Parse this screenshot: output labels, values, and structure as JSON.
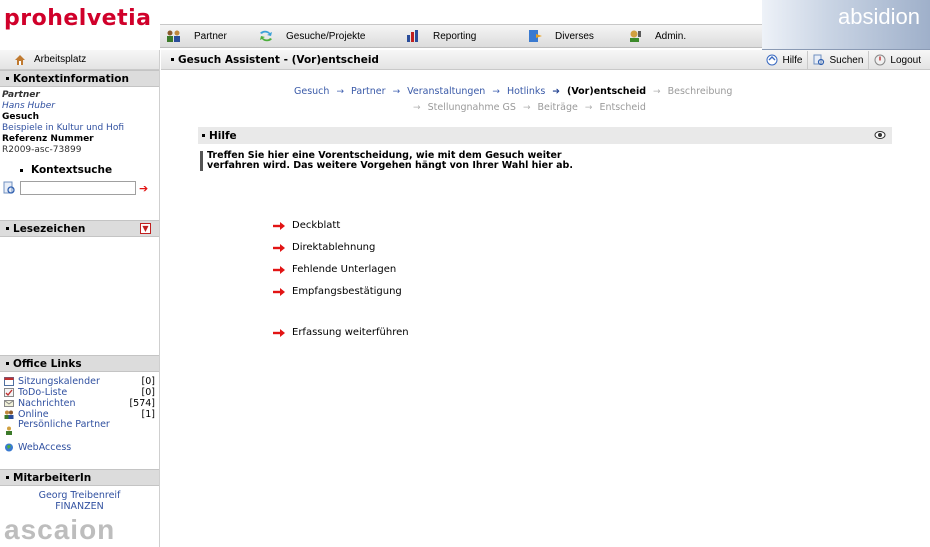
{
  "header": {
    "logo": "prohelvetia",
    "brand": "absidion",
    "nav": [
      {
        "label": "Partner",
        "icon": "partner-icon"
      },
      {
        "label": "Gesuche/Projekte",
        "icon": "projects-icon"
      },
      {
        "label": "Reporting",
        "icon": "reporting-icon"
      },
      {
        "label": "Diverses",
        "icon": "diverses-icon"
      },
      {
        "label": "Admin.",
        "icon": "admin-icon"
      }
    ]
  },
  "sidebar": {
    "home_label": "Arbeitsplatz",
    "kontext": {
      "title": "Kontextinformation",
      "partner_label": "Partner",
      "partner_value": "Hans Huber",
      "gesuch_label": "Gesuch",
      "gesuch_value": "Beispiele in Kultur und Hofi",
      "ref_label": "Referenz Nummer",
      "ref_value": "R2009-asc-73899",
      "search_title": "Kontextsuche",
      "search_value": ""
    },
    "lesezeichen": {
      "title": "Lesezeichen"
    },
    "office": {
      "title": "Office Links",
      "items": [
        {
          "label": "Sitzungskalender",
          "count": "[0]",
          "icon": "calendar-icon"
        },
        {
          "label": "ToDo-Liste",
          "count": "[0]",
          "icon": "todo-icon"
        },
        {
          "label": "Nachrichten",
          "count": "[574]",
          "icon": "mail-icon"
        },
        {
          "label": "Online",
          "count": "[1]",
          "icon": "users-online-icon"
        },
        {
          "label": "Persönliche Partner",
          "count": "",
          "icon": "person-icon"
        },
        {
          "label": "WebAccess",
          "count": "",
          "icon": "globe-icon"
        }
      ]
    },
    "mitarbeiter": {
      "title": "MitarbeiterIn",
      "name": "Georg Treibenreif",
      "dept": "FINANZEN"
    },
    "footer_logo": "ascaion"
  },
  "main": {
    "title": "Gesuch Assistent - (Vor)entscheid",
    "tools": [
      {
        "label": "Hilfe",
        "icon": "help-icon"
      },
      {
        "label": "Suchen",
        "icon": "search-icon"
      },
      {
        "label": "Logout",
        "icon": "logout-icon"
      }
    ],
    "breadcrumb": {
      "line1": [
        {
          "label": "Gesuch",
          "state": "link"
        },
        {
          "label": "Partner",
          "state": "link"
        },
        {
          "label": "Veranstaltungen",
          "state": "link"
        },
        {
          "label": "Hotlinks",
          "state": "link"
        },
        {
          "label": "(Vor)entscheid",
          "state": "current"
        },
        {
          "label": "Beschreibung",
          "state": "disabled"
        }
      ],
      "line2": [
        {
          "label": "Stellungnahme GS",
          "state": "disabled"
        },
        {
          "label": "Beiträge",
          "state": "disabled"
        },
        {
          "label": "Entscheid",
          "state": "disabled"
        }
      ]
    },
    "hilfe": {
      "title": "Hilfe",
      "text": "Treffen Sie hier eine Vorentscheidung, wie mit dem Gesuch weiter verfahren wird. Das weitere Vorgehen hängt von Ihrer Wahl hier ab."
    },
    "actions": [
      {
        "label": "Deckblatt"
      },
      {
        "label": "Direktablehnung"
      },
      {
        "label": "Fehlende Unterlagen"
      },
      {
        "label": "Empfangsbestätigung"
      },
      {
        "label": "Erfassung weiterführen"
      }
    ]
  },
  "colors": {
    "logo_red": "#d0002a",
    "link_blue": "#3a5aa8",
    "arrow_red": "#e21414",
    "panel_grey": "#dcdcdc"
  }
}
